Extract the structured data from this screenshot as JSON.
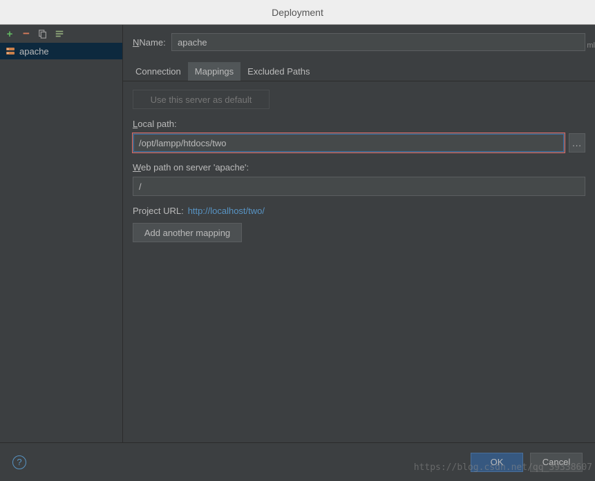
{
  "title": "Deployment",
  "sidebar": {
    "items": [
      {
        "label": "apache",
        "selected": true
      }
    ]
  },
  "name": {
    "label": "Name:",
    "value": "apache"
  },
  "tabs": [
    {
      "label": "Connection",
      "active": false
    },
    {
      "label": "Mappings",
      "active": true
    },
    {
      "label": "Excluded Paths",
      "active": false
    }
  ],
  "mappings": {
    "default_button": "Use this server as default",
    "local_path_label": "Local path:",
    "local_path_value": "/opt/lampp/htdocs/two",
    "web_path_label": "Web path on server 'apache':",
    "web_path_value": "/",
    "project_url_label": "Project URL: ",
    "project_url_value": "http://localhost/two/",
    "add_mapping_button": "Add another mapping",
    "browse_label": "..."
  },
  "footer": {
    "ok": "OK",
    "cancel": "Cancel"
  },
  "edge_text": "ml",
  "watermark": "https://blog.csdn.net/qq_39338607"
}
